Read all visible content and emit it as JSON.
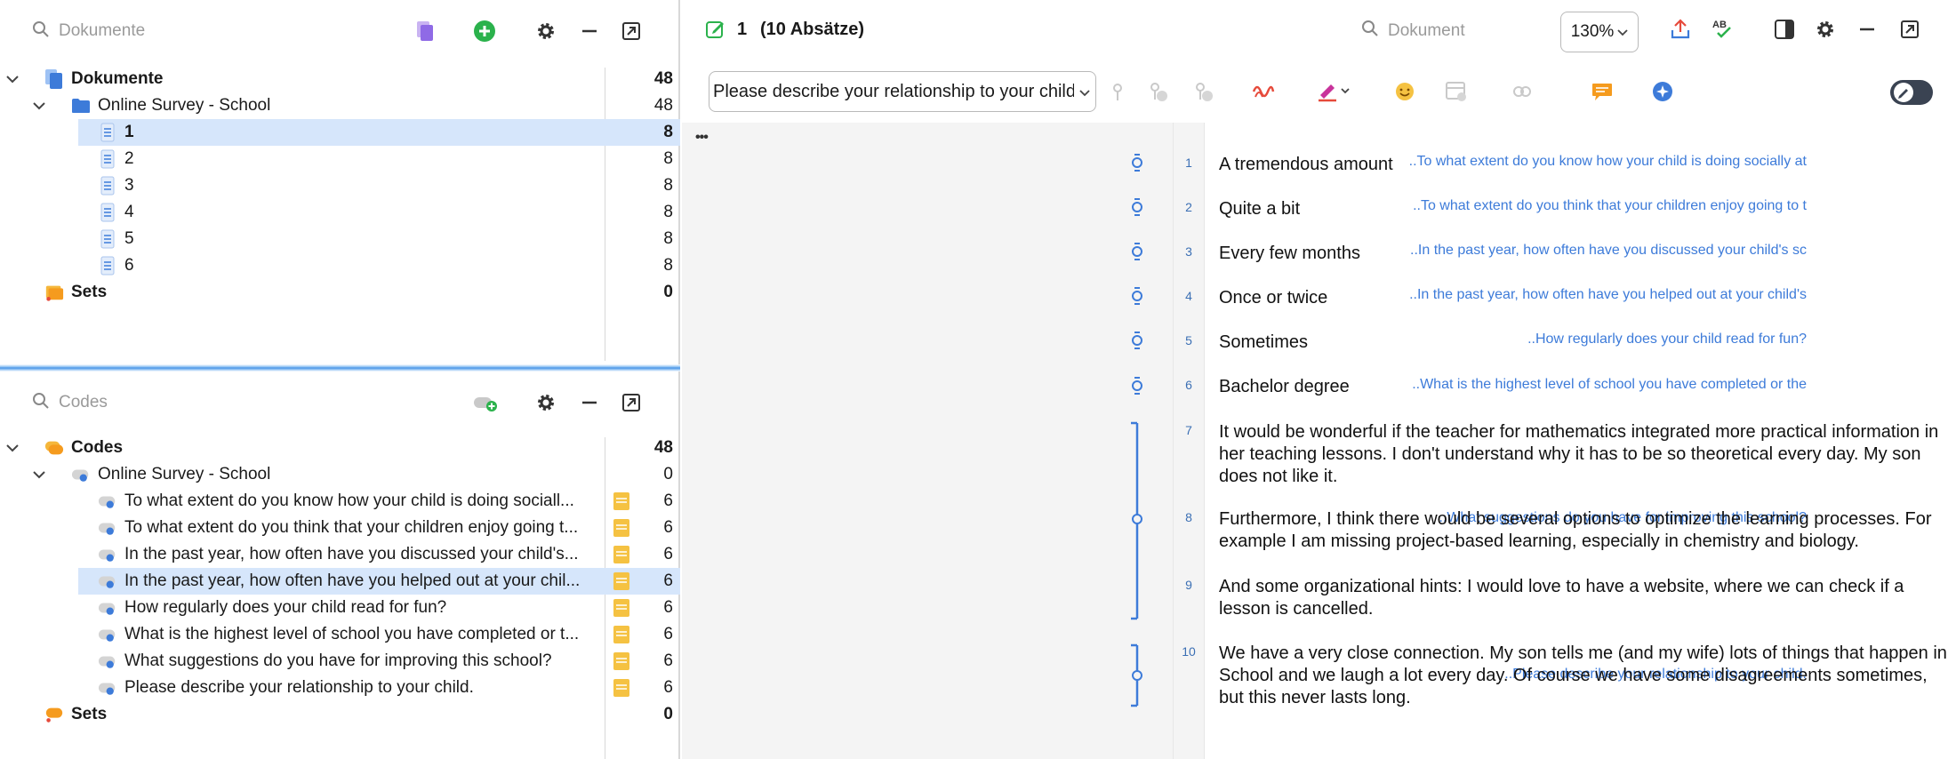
{
  "colors": {
    "accent": "#3d7bd9",
    "selection": "#d6e6fb",
    "memo": "#f5c242",
    "add_green": "#2bb24c"
  },
  "documents_panel": {
    "search_placeholder": "Dokumente",
    "root": {
      "label": "Dokumente",
      "count": "48"
    },
    "folder": {
      "label": "Online Survey - School",
      "count": "48"
    },
    "items": [
      {
        "label": "1",
        "count": "8"
      },
      {
        "label": "2",
        "count": "8"
      },
      {
        "label": "3",
        "count": "8"
      },
      {
        "label": "4",
        "count": "8"
      },
      {
        "label": "5",
        "count": "8"
      },
      {
        "label": "6",
        "count": "8"
      }
    ],
    "sets": {
      "label": "Sets",
      "count": "0"
    }
  },
  "codes_panel": {
    "search_placeholder": "Codes",
    "root": {
      "label": "Codes",
      "count": "48"
    },
    "folder": {
      "label": "Online Survey - School",
      "count": "0"
    },
    "items": [
      {
        "label": "To what extent do you know how your child is doing sociall...",
        "count": "6"
      },
      {
        "label": "To what extent do you think that your children enjoy going t...",
        "count": "6"
      },
      {
        "label": "In the past year, how often have you discussed your child's...",
        "count": "6"
      },
      {
        "label": "In the past year, how often have you helped out at your chil...",
        "count": "6"
      },
      {
        "label": "How regularly does your child read for fun?",
        "count": "6"
      },
      {
        "label": "What is the highest level of school you have completed or t...",
        "count": "6"
      },
      {
        "label": "What suggestions do you have for improving this school?",
        "count": "6"
      },
      {
        "label": "Please describe your relationship to your child.",
        "count": "6"
      }
    ],
    "sets": {
      "label": "Sets",
      "count": "0"
    }
  },
  "document_view": {
    "doc_number": "1",
    "paragraph_info": "(10 Absätze)",
    "search_placeholder": "Dokument",
    "zoom": "130%",
    "code_select_value": "Please describe your relationship to your child.",
    "ellipsis": "•••",
    "stripe_labels": [
      "..To what extent do you know how your child is doing socially at",
      "..To what extent do you think that your children enjoy going to t",
      "..In the past year, how often have you discussed your child's sc",
      "..In the past year, how often have you helped out at your child's",
      "..How regularly does your child read for fun?",
      "..What is the highest level of school you have completed or the",
      "..What suggestions do you have for improving this school?",
      "..Please describe your relationship to your child."
    ],
    "paragraphs": [
      {
        "num": "1",
        "text": "A tremendous amount"
      },
      {
        "num": "2",
        "text": "Quite a bit"
      },
      {
        "num": "3",
        "text": "Every few months"
      },
      {
        "num": "4",
        "text": "Once or twice"
      },
      {
        "num": "5",
        "text": "Sometimes"
      },
      {
        "num": "6",
        "text": "Bachelor degree"
      },
      {
        "num": "7",
        "text": "It would be wonderful if the teacher for mathematics integrated more practical information in her teaching lessons. I don't understand why it has to be so theoretical every day. My son does not like it."
      },
      {
        "num": "8",
        "text": "Furthermore, I think there would be several options to optimize the learning processes. For example I am missing project-based learning, especially in chemistry and biology."
      },
      {
        "num": "9",
        "text": "And some organizational hints: I would love to have a website, where we can check if a lesson is cancelled."
      },
      {
        "num": "10",
        "text": "We have a very close connection. My son tells me (and my wife) lots of things that happen in School and we laugh a lot every day. Of course we have some disagreements sometimes, but this never lasts long."
      }
    ]
  }
}
